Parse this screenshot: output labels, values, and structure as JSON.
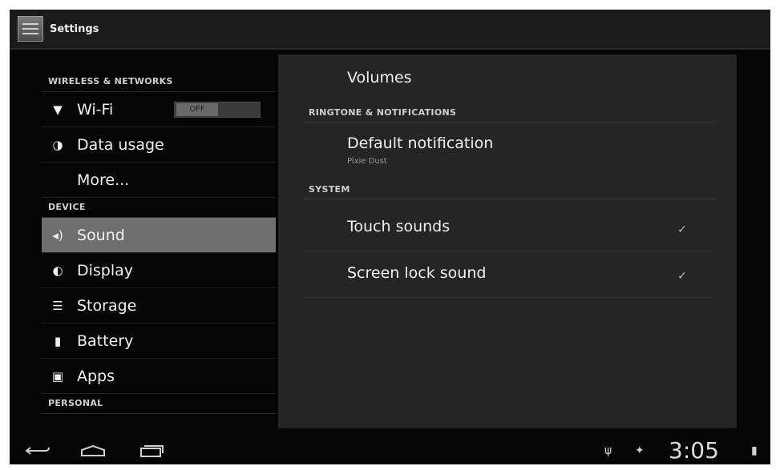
{
  "app": {
    "title": "Settings"
  },
  "left_pane": {
    "sections": [
      {
        "header": "WIRELESS & NETWORKS"
      },
      {
        "header": "DEVICE"
      },
      {
        "header": "PERSONAL"
      }
    ],
    "items": [
      {
        "label": "Wi-Fi",
        "icon": "wifi-icon",
        "toggle": "OFF"
      },
      {
        "label": "Data usage",
        "icon": "data-usage-icon"
      },
      {
        "label": "More..."
      },
      {
        "label": "Sound",
        "icon": "sound-icon",
        "selected": true
      },
      {
        "label": "Display",
        "icon": "display-icon"
      },
      {
        "label": "Storage",
        "icon": "storage-icon"
      },
      {
        "label": "Battery",
        "icon": "battery-icon"
      },
      {
        "label": "Apps",
        "icon": "apps-icon"
      }
    ]
  },
  "right_pane": {
    "volumes": "Volumes",
    "ringtone_header": "RINGTONE & NOTIFICATIONS",
    "default_notification": {
      "label": "Default notification",
      "value": "Pixie Dust"
    },
    "system_header": "SYSTEM",
    "touch_sounds": {
      "label": "Touch sounds",
      "checked": true
    },
    "screen_lock_sound": {
      "label": "Screen lock sound",
      "checked": true
    }
  },
  "status_bar": {
    "clock": "3:05"
  },
  "colors": {
    "selected_bg": "#6e6e6e",
    "pane_bg": "#252525",
    "screen_bg": "#050505"
  }
}
